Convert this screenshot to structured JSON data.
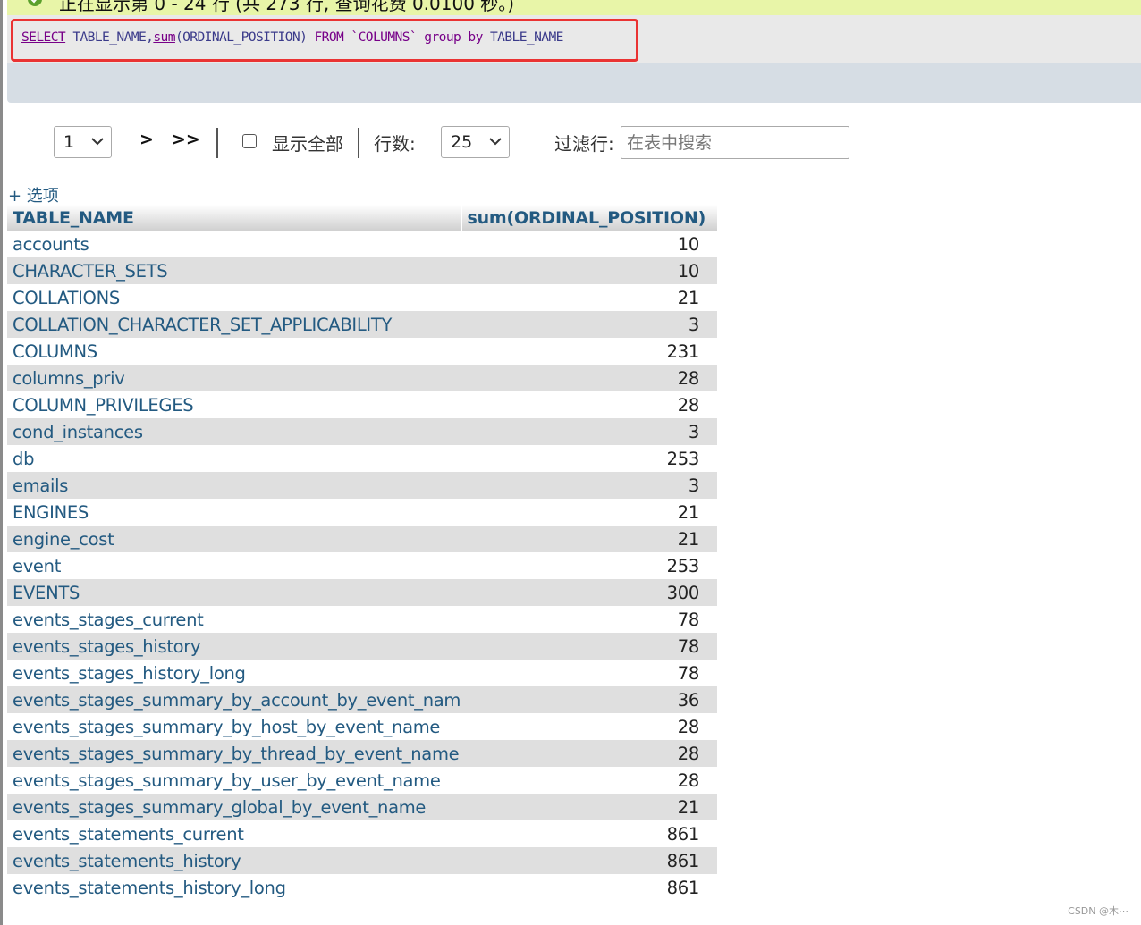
{
  "notice": {
    "text": "正在显示第 0 - 24 行 (共 273 行, 查询花费 0.0100 秒。)"
  },
  "sql": {
    "select": "SELECT",
    "col1": "TABLE_NAME,",
    "fn": "sum",
    "fn_arg": "(ORDINAL_POSITION)",
    "from": "FROM",
    "table": "`COLUMNS`",
    "group_by": "group by",
    "col2": "TABLE_NAME"
  },
  "nav": {
    "page_value": "1",
    "next_label": ">",
    "last_label": ">>",
    "show_all_label": "显示全部",
    "rows_label": "行数:",
    "rows_value": "25",
    "filter_label": "过滤行:",
    "filter_placeholder": "在表中搜索"
  },
  "options_label": "+ 选项",
  "table": {
    "columns": [
      "TABLE_NAME",
      "sum(ORDINAL_POSITION)"
    ],
    "rows": [
      {
        "name": "accounts",
        "value": "10"
      },
      {
        "name": "CHARACTER_SETS",
        "value": "10"
      },
      {
        "name": "COLLATIONS",
        "value": "21"
      },
      {
        "name": "COLLATION_CHARACTER_SET_APPLICABILITY",
        "value": "3"
      },
      {
        "name": "COLUMNS",
        "value": "231"
      },
      {
        "name": "columns_priv",
        "value": "28"
      },
      {
        "name": "COLUMN_PRIVILEGES",
        "value": "28"
      },
      {
        "name": "cond_instances",
        "value": "3"
      },
      {
        "name": "db",
        "value": "253"
      },
      {
        "name": "emails",
        "value": "3"
      },
      {
        "name": "ENGINES",
        "value": "21"
      },
      {
        "name": "engine_cost",
        "value": "21"
      },
      {
        "name": "event",
        "value": "253"
      },
      {
        "name": "EVENTS",
        "value": "300"
      },
      {
        "name": "events_stages_current",
        "value": "78"
      },
      {
        "name": "events_stages_history",
        "value": "78"
      },
      {
        "name": "events_stages_history_long",
        "value": "78"
      },
      {
        "name": "events_stages_summary_by_account_by_event_name",
        "value": "36"
      },
      {
        "name": "events_stages_summary_by_host_by_event_name",
        "value": "28"
      },
      {
        "name": "events_stages_summary_by_thread_by_event_name",
        "value": "28"
      },
      {
        "name": "events_stages_summary_by_user_by_event_name",
        "value": "28"
      },
      {
        "name": "events_stages_summary_global_by_event_name",
        "value": "21"
      },
      {
        "name": "events_statements_current",
        "value": "861"
      },
      {
        "name": "events_statements_history",
        "value": "861"
      },
      {
        "name": "events_statements_history_long",
        "value": "861"
      }
    ]
  },
  "watermark": "CSDN @木⋯",
  "colors": {
    "highlight_frame": "#ea3333",
    "link": "#235a81",
    "notice_bg": "#e8f5a8"
  },
  "icons": {
    "success": "check-circle-icon",
    "dropdown": "chevron-down-icon"
  }
}
